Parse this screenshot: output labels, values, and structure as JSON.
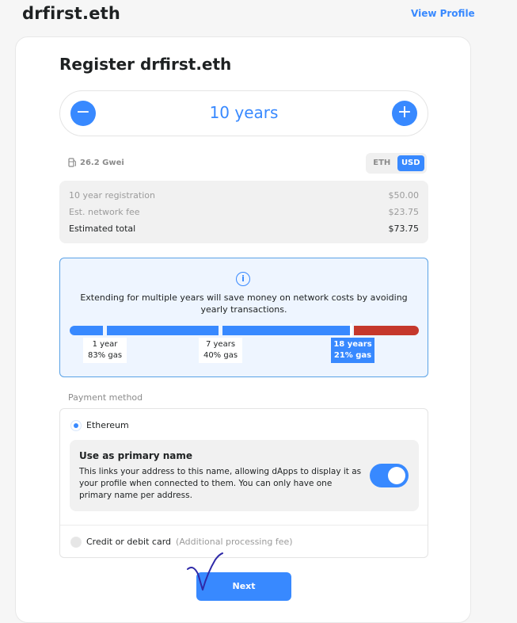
{
  "header": {
    "name": "drfirst.eth",
    "view_profile": "View Profile"
  },
  "register": {
    "title": "Register drfirst.eth",
    "years": "10 years",
    "minus": "−",
    "plus": "+"
  },
  "gas": {
    "price": "26.2 Gwei"
  },
  "currency": {
    "options": [
      "ETH",
      "USD"
    ],
    "selected": "USD"
  },
  "fees": {
    "rows": [
      {
        "label": "10 year registration",
        "value": "$50.00"
      },
      {
        "label": "Est. network fee",
        "value": "$23.75"
      },
      {
        "label": "Estimated total",
        "value": "$73.75"
      }
    ]
  },
  "info": {
    "icon": "i",
    "text": "Extending for multiple years will save money on network costs by avoiding yearly transactions.",
    "ticks": [
      {
        "years": "1 year",
        "gas": "83% gas"
      },
      {
        "years": "7 years",
        "gas": "40% gas"
      },
      {
        "years": "18 years",
        "gas": "21% gas"
      }
    ]
  },
  "payment": {
    "label": "Payment method",
    "ethereum": "Ethereum",
    "primary_title": "Use as primary name",
    "primary_desc": "This links your address to this name, allowing dApps to display it as your profile when connected to them. You can only have one primary name per address.",
    "primary_enabled": true,
    "card": "Credit or debit card",
    "card_note": "(Additional processing fee)"
  },
  "actions": {
    "next": "Next"
  },
  "colors": {
    "accent": "#3889ff",
    "bar_red": "#c5382c"
  }
}
